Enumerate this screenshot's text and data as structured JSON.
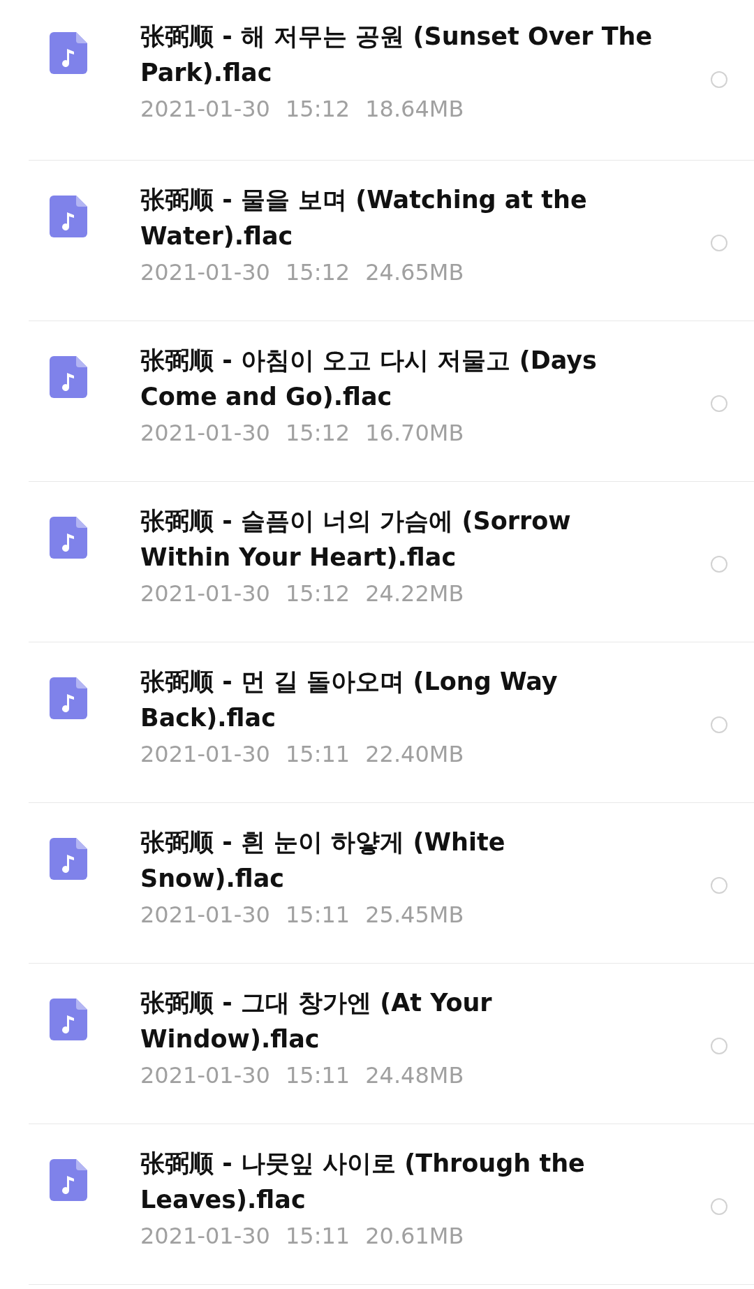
{
  "files": [
    {
      "name": "张弼顺 - 해 저무는 공원 (Sunset Over The Park).flac",
      "date": "2021-01-30",
      "time": "15:12",
      "size": "18.64MB",
      "selected": false
    },
    {
      "name": "张弼顺 - 물을 보며 (Watching at the Water).flac",
      "date": "2021-01-30",
      "time": "15:12",
      "size": "24.65MB",
      "selected": false
    },
    {
      "name": "张弼顺 - 아침이 오고 다시 저물고 (Days Come and Go).flac",
      "date": "2021-01-30",
      "time": "15:12",
      "size": "16.70MB",
      "selected": false
    },
    {
      "name": "张弼顺 - 슬픔이 너의 가슴에 (Sorrow Within Your Heart).flac",
      "date": "2021-01-30",
      "time": "15:12",
      "size": "24.22MB",
      "selected": false
    },
    {
      "name": "张弼顺 - 먼 길 돌아오며 (Long Way Back).flac",
      "date": "2021-01-30",
      "time": "15:11",
      "size": "22.40MB",
      "selected": false
    },
    {
      "name": "张弼顺 - 흰 눈이 하얗게 (White Snow).flac",
      "date": "2021-01-30",
      "time": "15:11",
      "size": "25.45MB",
      "selected": false
    },
    {
      "name": "张弼顺 - 그대 창가엔 (At Your Window).flac",
      "date": "2021-01-30",
      "time": "15:11",
      "size": "24.48MB",
      "selected": false
    },
    {
      "name": "张弼顺 - 나뭇잎 사이로 (Through the Leaves).flac",
      "date": "2021-01-30",
      "time": "15:11",
      "size": "20.61MB",
      "selected": false
    }
  ]
}
